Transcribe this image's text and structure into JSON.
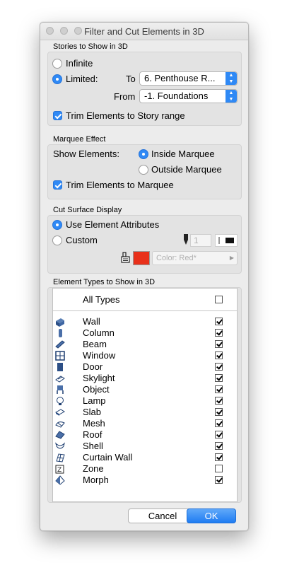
{
  "window": {
    "title": "Filter and Cut Elements in 3D"
  },
  "stories": {
    "section_label": "Stories to Show in 3D",
    "infinite_label": "Infinite",
    "limited_label": "Limited:",
    "to_label": "To",
    "to_value": "6. Penthouse R...",
    "from_label": "From",
    "from_value": "-1. Foundations",
    "trim_label": "Trim Elements to Story range"
  },
  "marquee": {
    "section_label": "Marquee Effect",
    "show_label": "Show Elements:",
    "inside_label": "Inside Marquee",
    "outside_label": "Outside Marquee",
    "trim_label": "Trim Elements to Marquee"
  },
  "cut": {
    "section_label": "Cut Surface Display",
    "use_attrs_label": "Use Element Attributes",
    "custom_label": "Custom",
    "pen_value": "1",
    "color_label": "Color: Red*",
    "swatch_color": "#e8301a"
  },
  "types": {
    "section_label": "Element Types to Show in 3D",
    "all_label": "All Types",
    "items": [
      {
        "label": "Wall",
        "icon": "wall-icon",
        "checked": true
      },
      {
        "label": "Column",
        "icon": "column-icon",
        "checked": true
      },
      {
        "label": "Beam",
        "icon": "beam-icon",
        "checked": true
      },
      {
        "label": "Window",
        "icon": "window-icon",
        "checked": true
      },
      {
        "label": "Door",
        "icon": "door-icon",
        "checked": true
      },
      {
        "label": "Skylight",
        "icon": "skylight-icon",
        "checked": true
      },
      {
        "label": "Object",
        "icon": "object-icon",
        "checked": true
      },
      {
        "label": "Lamp",
        "icon": "lamp-icon",
        "checked": true
      },
      {
        "label": "Slab",
        "icon": "slab-icon",
        "checked": true
      },
      {
        "label": "Mesh",
        "icon": "mesh-icon",
        "checked": true
      },
      {
        "label": "Roof",
        "icon": "roof-icon",
        "checked": true
      },
      {
        "label": "Shell",
        "icon": "shell-icon",
        "checked": true
      },
      {
        "label": "Curtain Wall",
        "icon": "curtain-wall-icon",
        "checked": true
      },
      {
        "label": "Zone",
        "icon": "zone-icon",
        "checked": false
      },
      {
        "label": "Morph",
        "icon": "morph-icon",
        "checked": true
      }
    ]
  },
  "buttons": {
    "cancel_label": "Cancel",
    "ok_label": "OK"
  }
}
